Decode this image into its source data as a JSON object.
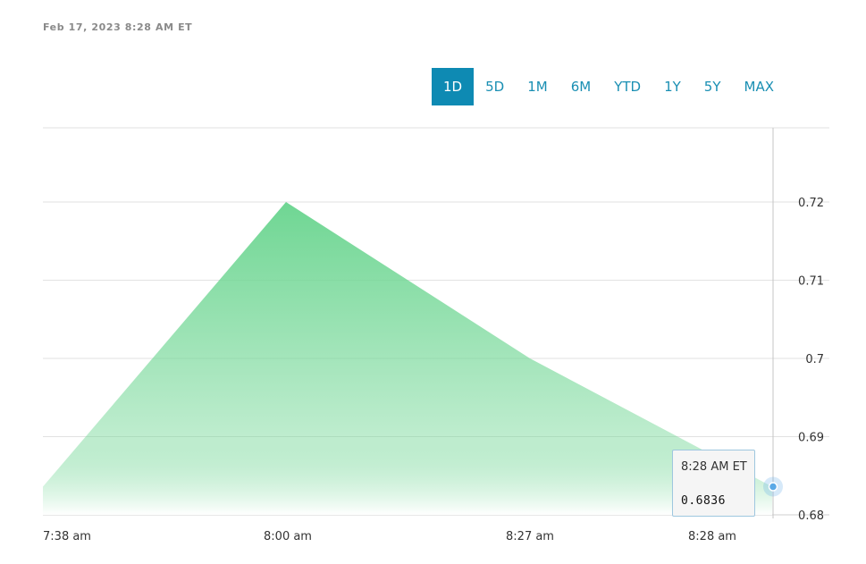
{
  "timestamp": "Feb 17, 2023 8:28 AM ET",
  "range_tabs": [
    {
      "label": "1D",
      "active": true
    },
    {
      "label": "5D",
      "active": false
    },
    {
      "label": "1M",
      "active": false
    },
    {
      "label": "6M",
      "active": false
    },
    {
      "label": "YTD",
      "active": false
    },
    {
      "label": "1Y",
      "active": false
    },
    {
      "label": "5Y",
      "active": false
    },
    {
      "label": "MAX",
      "active": false
    }
  ],
  "tooltip": {
    "time": "8:28 AM ET",
    "value": "0.6836"
  },
  "colors": {
    "area_top": "#6fd693",
    "area_bottom": "#ffffff",
    "accent": "#0e8ab3",
    "marker": "#5aa9e6"
  },
  "chart_data": {
    "type": "area",
    "x": [
      "7:38 am",
      "8:00 am",
      "8:27 am",
      "8:28 am"
    ],
    "x_tick_labels": [
      "7:38 am",
      "8:00 am",
      "8:27 am",
      "8:28 am"
    ],
    "points": [
      {
        "x": "7:38 am",
        "y": 0.6836
      },
      {
        "x": "8:00 am",
        "y": 0.72
      },
      {
        "x": "8:27 am",
        "y": 0.7
      },
      {
        "x": "8:28 am",
        "y": 0.6836
      }
    ],
    "y_ticks": [
      0.68,
      0.69,
      0.7,
      0.71,
      0.72
    ],
    "y_tick_labels": [
      "0.68",
      "0.69",
      "0.7",
      "0.71",
      "0.72"
    ],
    "ylim": [
      0.68,
      0.73
    ],
    "grid": true,
    "y_axis_side": "right"
  }
}
